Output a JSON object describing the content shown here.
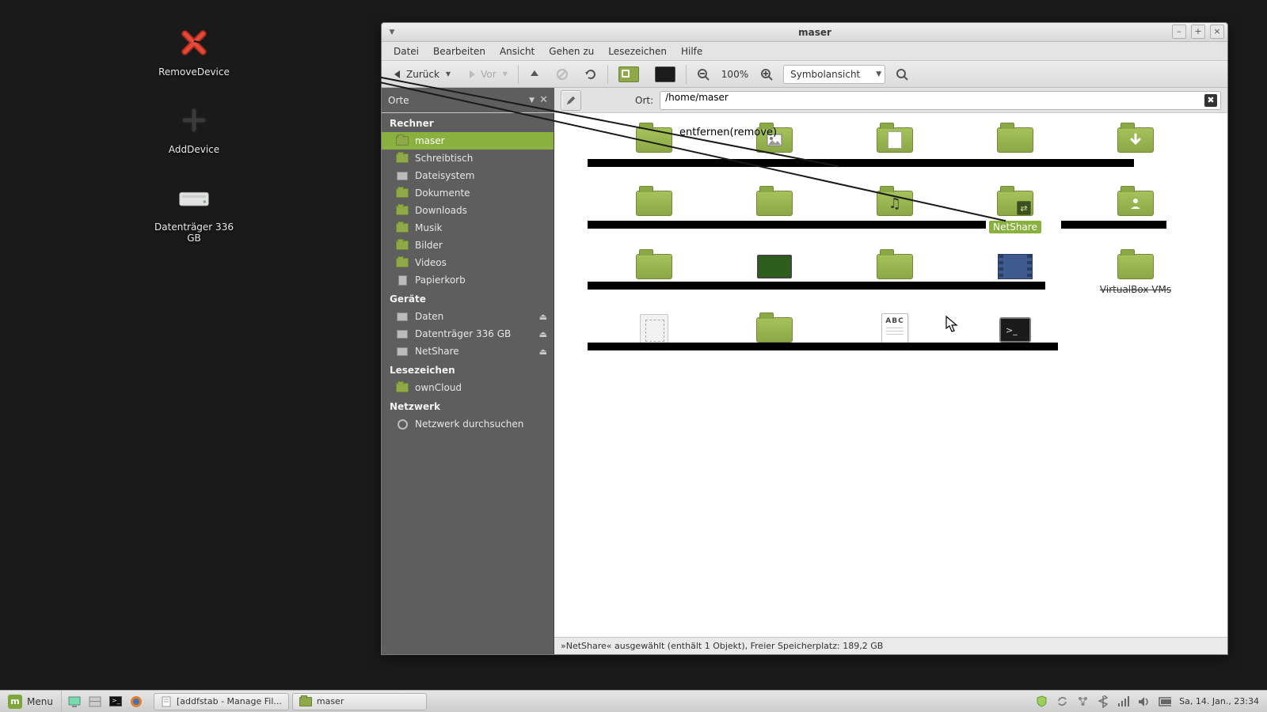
{
  "desktop": {
    "icons": [
      {
        "name": "remove-device",
        "label": "RemoveDevice"
      },
      {
        "name": "add-device",
        "label": "AddDevice"
      },
      {
        "name": "drive-336",
        "label": "Datenträger 336 GB"
      }
    ]
  },
  "window": {
    "title": "maser",
    "menu": {
      "file": "Datei",
      "edit": "Bearbeiten",
      "view": "Ansicht",
      "go": "Gehen zu",
      "bookmarks": "Lesezeichen",
      "help": "Hilfe"
    },
    "toolbar": {
      "back": "Zurück",
      "forward": "Vor",
      "zoom": "100%",
      "view_mode": "Symbolansicht"
    },
    "location": {
      "places_label": "Orte",
      "ort_label": "Ort:",
      "path": "/home/maser"
    },
    "sidebar": {
      "sections": {
        "computer": {
          "title": "Rechner",
          "items": [
            {
              "key": "home",
              "label": "maser",
              "icon": "home",
              "active": true
            },
            {
              "key": "desktop",
              "label": "Schreibtisch",
              "icon": "folder"
            },
            {
              "key": "filesystem",
              "label": "Dateisystem",
              "icon": "drive"
            },
            {
              "key": "documents",
              "label": "Dokumente",
              "icon": "folder"
            },
            {
              "key": "downloads",
              "label": "Downloads",
              "icon": "folder"
            },
            {
              "key": "music",
              "label": "Musik",
              "icon": "folder"
            },
            {
              "key": "pictures",
              "label": "Bilder",
              "icon": "folder"
            },
            {
              "key": "videos",
              "label": "Videos",
              "icon": "folder"
            },
            {
              "key": "trash",
              "label": "Papierkorb",
              "icon": "trash"
            }
          ]
        },
        "devices": {
          "title": "Geräte",
          "items": [
            {
              "key": "daten",
              "label": "Daten",
              "icon": "drive",
              "eject": true
            },
            {
              "key": "drive336",
              "label": "Datenträger 336 GB",
              "icon": "drive",
              "eject": true
            },
            {
              "key": "netshare",
              "label": "NetShare",
              "icon": "drive",
              "eject": true
            }
          ]
        },
        "bookmarks": {
          "title": "Lesezeichen",
          "items": [
            {
              "key": "owncloud",
              "label": "ownCloud",
              "icon": "folder"
            }
          ]
        },
        "network": {
          "title": "Netzwerk",
          "items": [
            {
              "key": "browsenet",
              "label": "Netzwerk durchsuchen",
              "icon": "globe"
            }
          ]
        }
      }
    },
    "grid": {
      "items": [
        {
          "key": "f01",
          "type": "folder",
          "label": ""
        },
        {
          "key": "f02",
          "type": "folder-pictures",
          "label": ""
        },
        {
          "key": "f03",
          "type": "folder-doc",
          "label": ""
        },
        {
          "key": "f04",
          "type": "folder",
          "label": ""
        },
        {
          "key": "f05",
          "type": "folder-download",
          "label": ""
        },
        {
          "key": "f06",
          "type": "folder",
          "label": ""
        },
        {
          "key": "f07",
          "type": "folder",
          "label": ""
        },
        {
          "key": "f08",
          "type": "folder-music",
          "label": ""
        },
        {
          "key": "netshare",
          "type": "folder-share",
          "label": "NetShare",
          "selected": true
        },
        {
          "key": "f10",
          "type": "folder-public",
          "label": ""
        },
        {
          "key": "f11",
          "type": "folder",
          "label": ""
        },
        {
          "key": "f12",
          "type": "desktop-folder",
          "label": ""
        },
        {
          "key": "f13",
          "type": "folder",
          "label": ""
        },
        {
          "key": "f14",
          "type": "videos-folder",
          "label": ""
        },
        {
          "key": "f15",
          "type": "folder",
          "label": "VirtualBox VMs"
        },
        {
          "key": "f16",
          "type": "templates",
          "label": ""
        },
        {
          "key": "f17",
          "type": "folder",
          "label": ""
        },
        {
          "key": "f18",
          "type": "text-file",
          "label": ""
        },
        {
          "key": "f19",
          "type": "terminal-script",
          "label": ""
        }
      ]
    },
    "status": "»NetShare« ausgewählt (enthält 1 Objekt), Freier Speicherplatz: 189,2 GB"
  },
  "annotation": {
    "remove_label": "entfernen(remove)"
  },
  "taskbar": {
    "menu": "Menu",
    "tasks": [
      {
        "key": "gedit",
        "label": "[addfstab - Manage Fil...",
        "icon": "doc"
      },
      {
        "key": "caja",
        "label": "maser",
        "icon": "folder"
      }
    ],
    "clock": "Sa, 14. Jan., 23:34"
  }
}
